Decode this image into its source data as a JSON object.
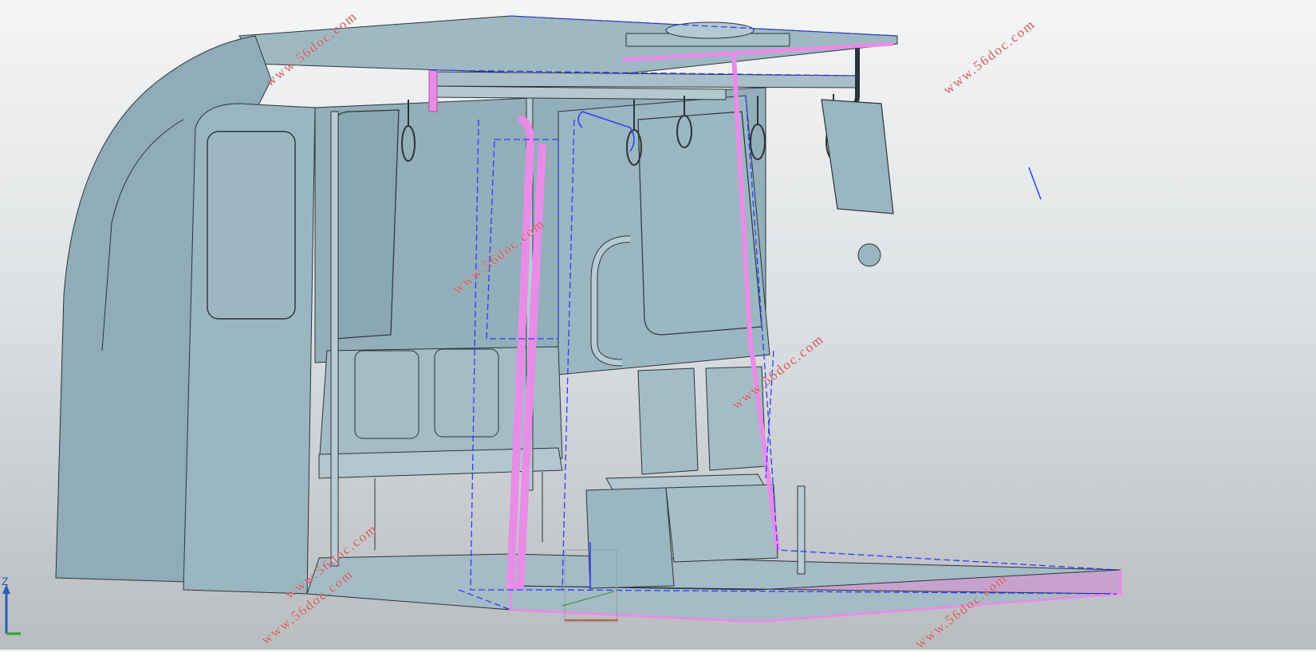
{
  "watermarks": [
    {
      "text": "www.56doc.com"
    },
    {
      "text": "www.56doc.com"
    },
    {
      "text": "www.56doc.com"
    },
    {
      "text": "www.56doc.com"
    },
    {
      "text": "www.56doc.com"
    },
    {
      "text": "www.56doc.com"
    },
    {
      "text": "www.56doc.com"
    }
  ],
  "axis_triad": {
    "label": "Z"
  },
  "colors": {
    "body": "#98b4bf",
    "body_dark": "#7f9ca8",
    "floor": "#a9bfc8",
    "edge": "#2b3438",
    "highlight": "#e98ce8",
    "dashed": "#2a3cff"
  }
}
